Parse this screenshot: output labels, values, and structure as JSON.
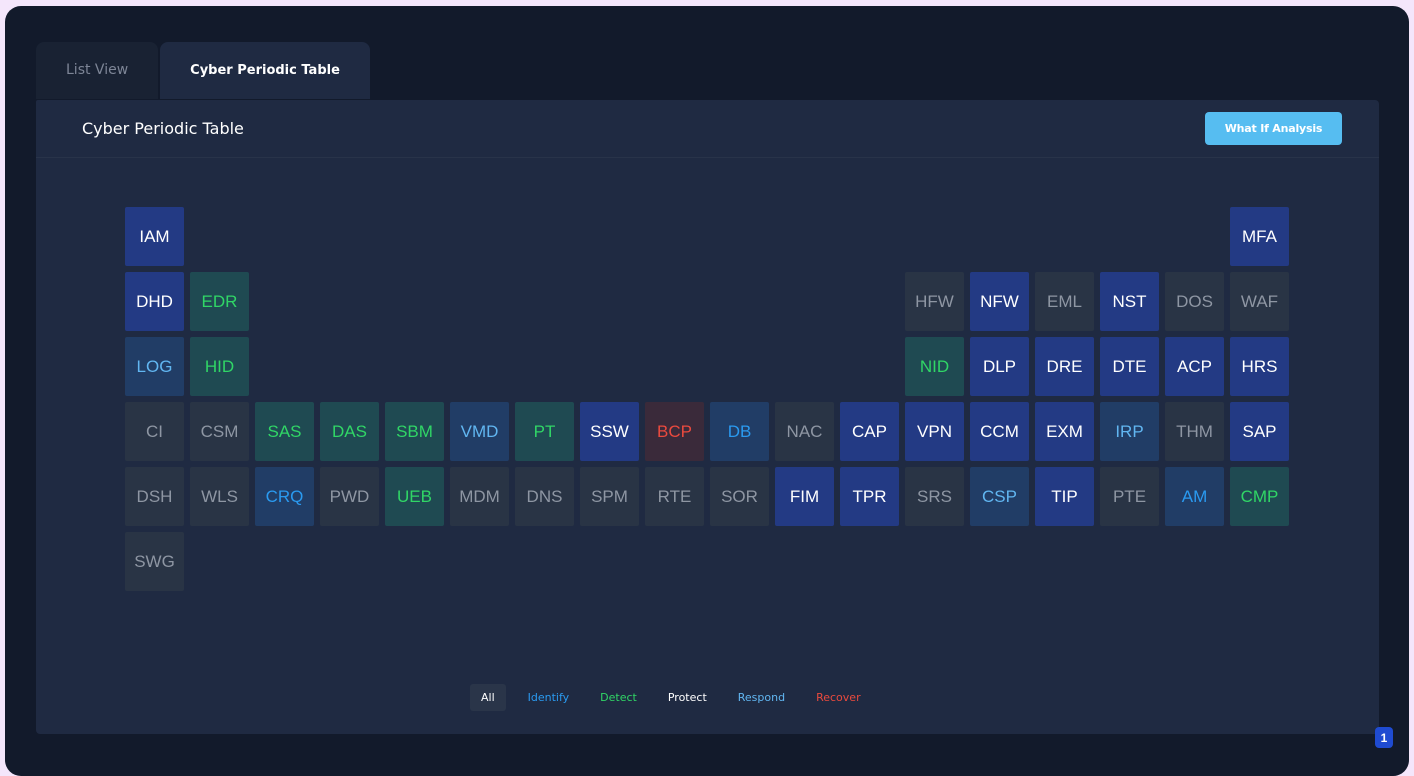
{
  "tabs": [
    {
      "label": "List View",
      "active": false
    },
    {
      "label": "Cyber Periodic Table",
      "active": true
    }
  ],
  "panel": {
    "title": "Cyber Periodic Table",
    "what_if_button": "What If Analysis"
  },
  "categories": {
    "neutral": "#8e96a3",
    "protect": "#ffffff",
    "detect": "#30d666",
    "identify": "#2a9af0",
    "respond": "#61b6f1",
    "recover": "#ea4a3e"
  },
  "elements": [
    {
      "code": "IAM",
      "row": 0,
      "col": 0,
      "category": "protect"
    },
    {
      "code": "MFA",
      "row": 0,
      "col": 17,
      "category": "protect"
    },
    {
      "code": "DHD",
      "row": 1,
      "col": 0,
      "category": "protect"
    },
    {
      "code": "EDR",
      "row": 1,
      "col": 1,
      "category": "detect"
    },
    {
      "code": "HFW",
      "row": 1,
      "col": 12,
      "category": "neutral"
    },
    {
      "code": "NFW",
      "row": 1,
      "col": 13,
      "category": "protect"
    },
    {
      "code": "EML",
      "row": 1,
      "col": 14,
      "category": "neutral"
    },
    {
      "code": "NST",
      "row": 1,
      "col": 15,
      "category": "protect"
    },
    {
      "code": "DOS",
      "row": 1,
      "col": 16,
      "category": "neutral"
    },
    {
      "code": "WAF",
      "row": 1,
      "col": 17,
      "category": "neutral"
    },
    {
      "code": "LOG",
      "row": 2,
      "col": 0,
      "category": "respond"
    },
    {
      "code": "HID",
      "row": 2,
      "col": 1,
      "category": "detect"
    },
    {
      "code": "NID",
      "row": 2,
      "col": 12,
      "category": "detect"
    },
    {
      "code": "DLP",
      "row": 2,
      "col": 13,
      "category": "protect"
    },
    {
      "code": "DRE",
      "row": 2,
      "col": 14,
      "category": "protect"
    },
    {
      "code": "DTE",
      "row": 2,
      "col": 15,
      "category": "protect"
    },
    {
      "code": "ACP",
      "row": 2,
      "col": 16,
      "category": "protect"
    },
    {
      "code": "HRS",
      "row": 2,
      "col": 17,
      "category": "protect"
    },
    {
      "code": "CI",
      "row": 3,
      "col": 0,
      "category": "neutral"
    },
    {
      "code": "CSM",
      "row": 3,
      "col": 1,
      "category": "neutral"
    },
    {
      "code": "SAS",
      "row": 3,
      "col": 2,
      "category": "detect"
    },
    {
      "code": "DAS",
      "row": 3,
      "col": 3,
      "category": "detect"
    },
    {
      "code": "SBM",
      "row": 3,
      "col": 4,
      "category": "detect"
    },
    {
      "code": "VMD",
      "row": 3,
      "col": 5,
      "category": "respond"
    },
    {
      "code": "PT",
      "row": 3,
      "col": 6,
      "category": "detect"
    },
    {
      "code": "SSW",
      "row": 3,
      "col": 7,
      "category": "protect"
    },
    {
      "code": "BCP",
      "row": 3,
      "col": 8,
      "category": "recover"
    },
    {
      "code": "DB",
      "row": 3,
      "col": 9,
      "category": "identify"
    },
    {
      "code": "NAC",
      "row": 3,
      "col": 10,
      "category": "neutral"
    },
    {
      "code": "CAP",
      "row": 3,
      "col": 11,
      "category": "protect"
    },
    {
      "code": "VPN",
      "row": 3,
      "col": 12,
      "category": "protect"
    },
    {
      "code": "CCM",
      "row": 3,
      "col": 13,
      "category": "protect"
    },
    {
      "code": "EXM",
      "row": 3,
      "col": 14,
      "category": "protect"
    },
    {
      "code": "IRP",
      "row": 3,
      "col": 15,
      "category": "respond"
    },
    {
      "code": "THM",
      "row": 3,
      "col": 16,
      "category": "neutral"
    },
    {
      "code": "SAP",
      "row": 3,
      "col": 17,
      "category": "protect"
    },
    {
      "code": "DSH",
      "row": 4,
      "col": 0,
      "category": "neutral"
    },
    {
      "code": "WLS",
      "row": 4,
      "col": 1,
      "category": "neutral"
    },
    {
      "code": "CRQ",
      "row": 4,
      "col": 2,
      "category": "identify"
    },
    {
      "code": "PWD",
      "row": 4,
      "col": 3,
      "category": "neutral"
    },
    {
      "code": "UEB",
      "row": 4,
      "col": 4,
      "category": "detect"
    },
    {
      "code": "MDM",
      "row": 4,
      "col": 5,
      "category": "neutral"
    },
    {
      "code": "DNS",
      "row": 4,
      "col": 6,
      "category": "neutral"
    },
    {
      "code": "SPM",
      "row": 4,
      "col": 7,
      "category": "neutral"
    },
    {
      "code": "RTE",
      "row": 4,
      "col": 8,
      "category": "neutral"
    },
    {
      "code": "SOR",
      "row": 4,
      "col": 9,
      "category": "neutral"
    },
    {
      "code": "FIM",
      "row": 4,
      "col": 10,
      "category": "protect"
    },
    {
      "code": "TPR",
      "row": 4,
      "col": 11,
      "category": "protect"
    },
    {
      "code": "SRS",
      "row": 4,
      "col": 12,
      "category": "neutral"
    },
    {
      "code": "CSP",
      "row": 4,
      "col": 13,
      "category": "respond"
    },
    {
      "code": "TIP",
      "row": 4,
      "col": 14,
      "category": "protect"
    },
    {
      "code": "PTE",
      "row": 4,
      "col": 15,
      "category": "neutral"
    },
    {
      "code": "AM",
      "row": 4,
      "col": 16,
      "category": "identify"
    },
    {
      "code": "CMP",
      "row": 4,
      "col": 17,
      "category": "detect"
    },
    {
      "code": "SWG",
      "row": 5,
      "col": 0,
      "category": "neutral"
    }
  ],
  "legend": [
    {
      "label": "All",
      "key": "all",
      "active": true
    },
    {
      "label": "Identify",
      "key": "identify",
      "active": false
    },
    {
      "label": "Detect",
      "key": "detect",
      "active": false
    },
    {
      "label": "Protect",
      "key": "protect",
      "active": false
    },
    {
      "label": "Respond",
      "key": "respond",
      "active": false
    },
    {
      "label": "Recover",
      "key": "recover",
      "active": false
    }
  ],
  "badge": "1"
}
